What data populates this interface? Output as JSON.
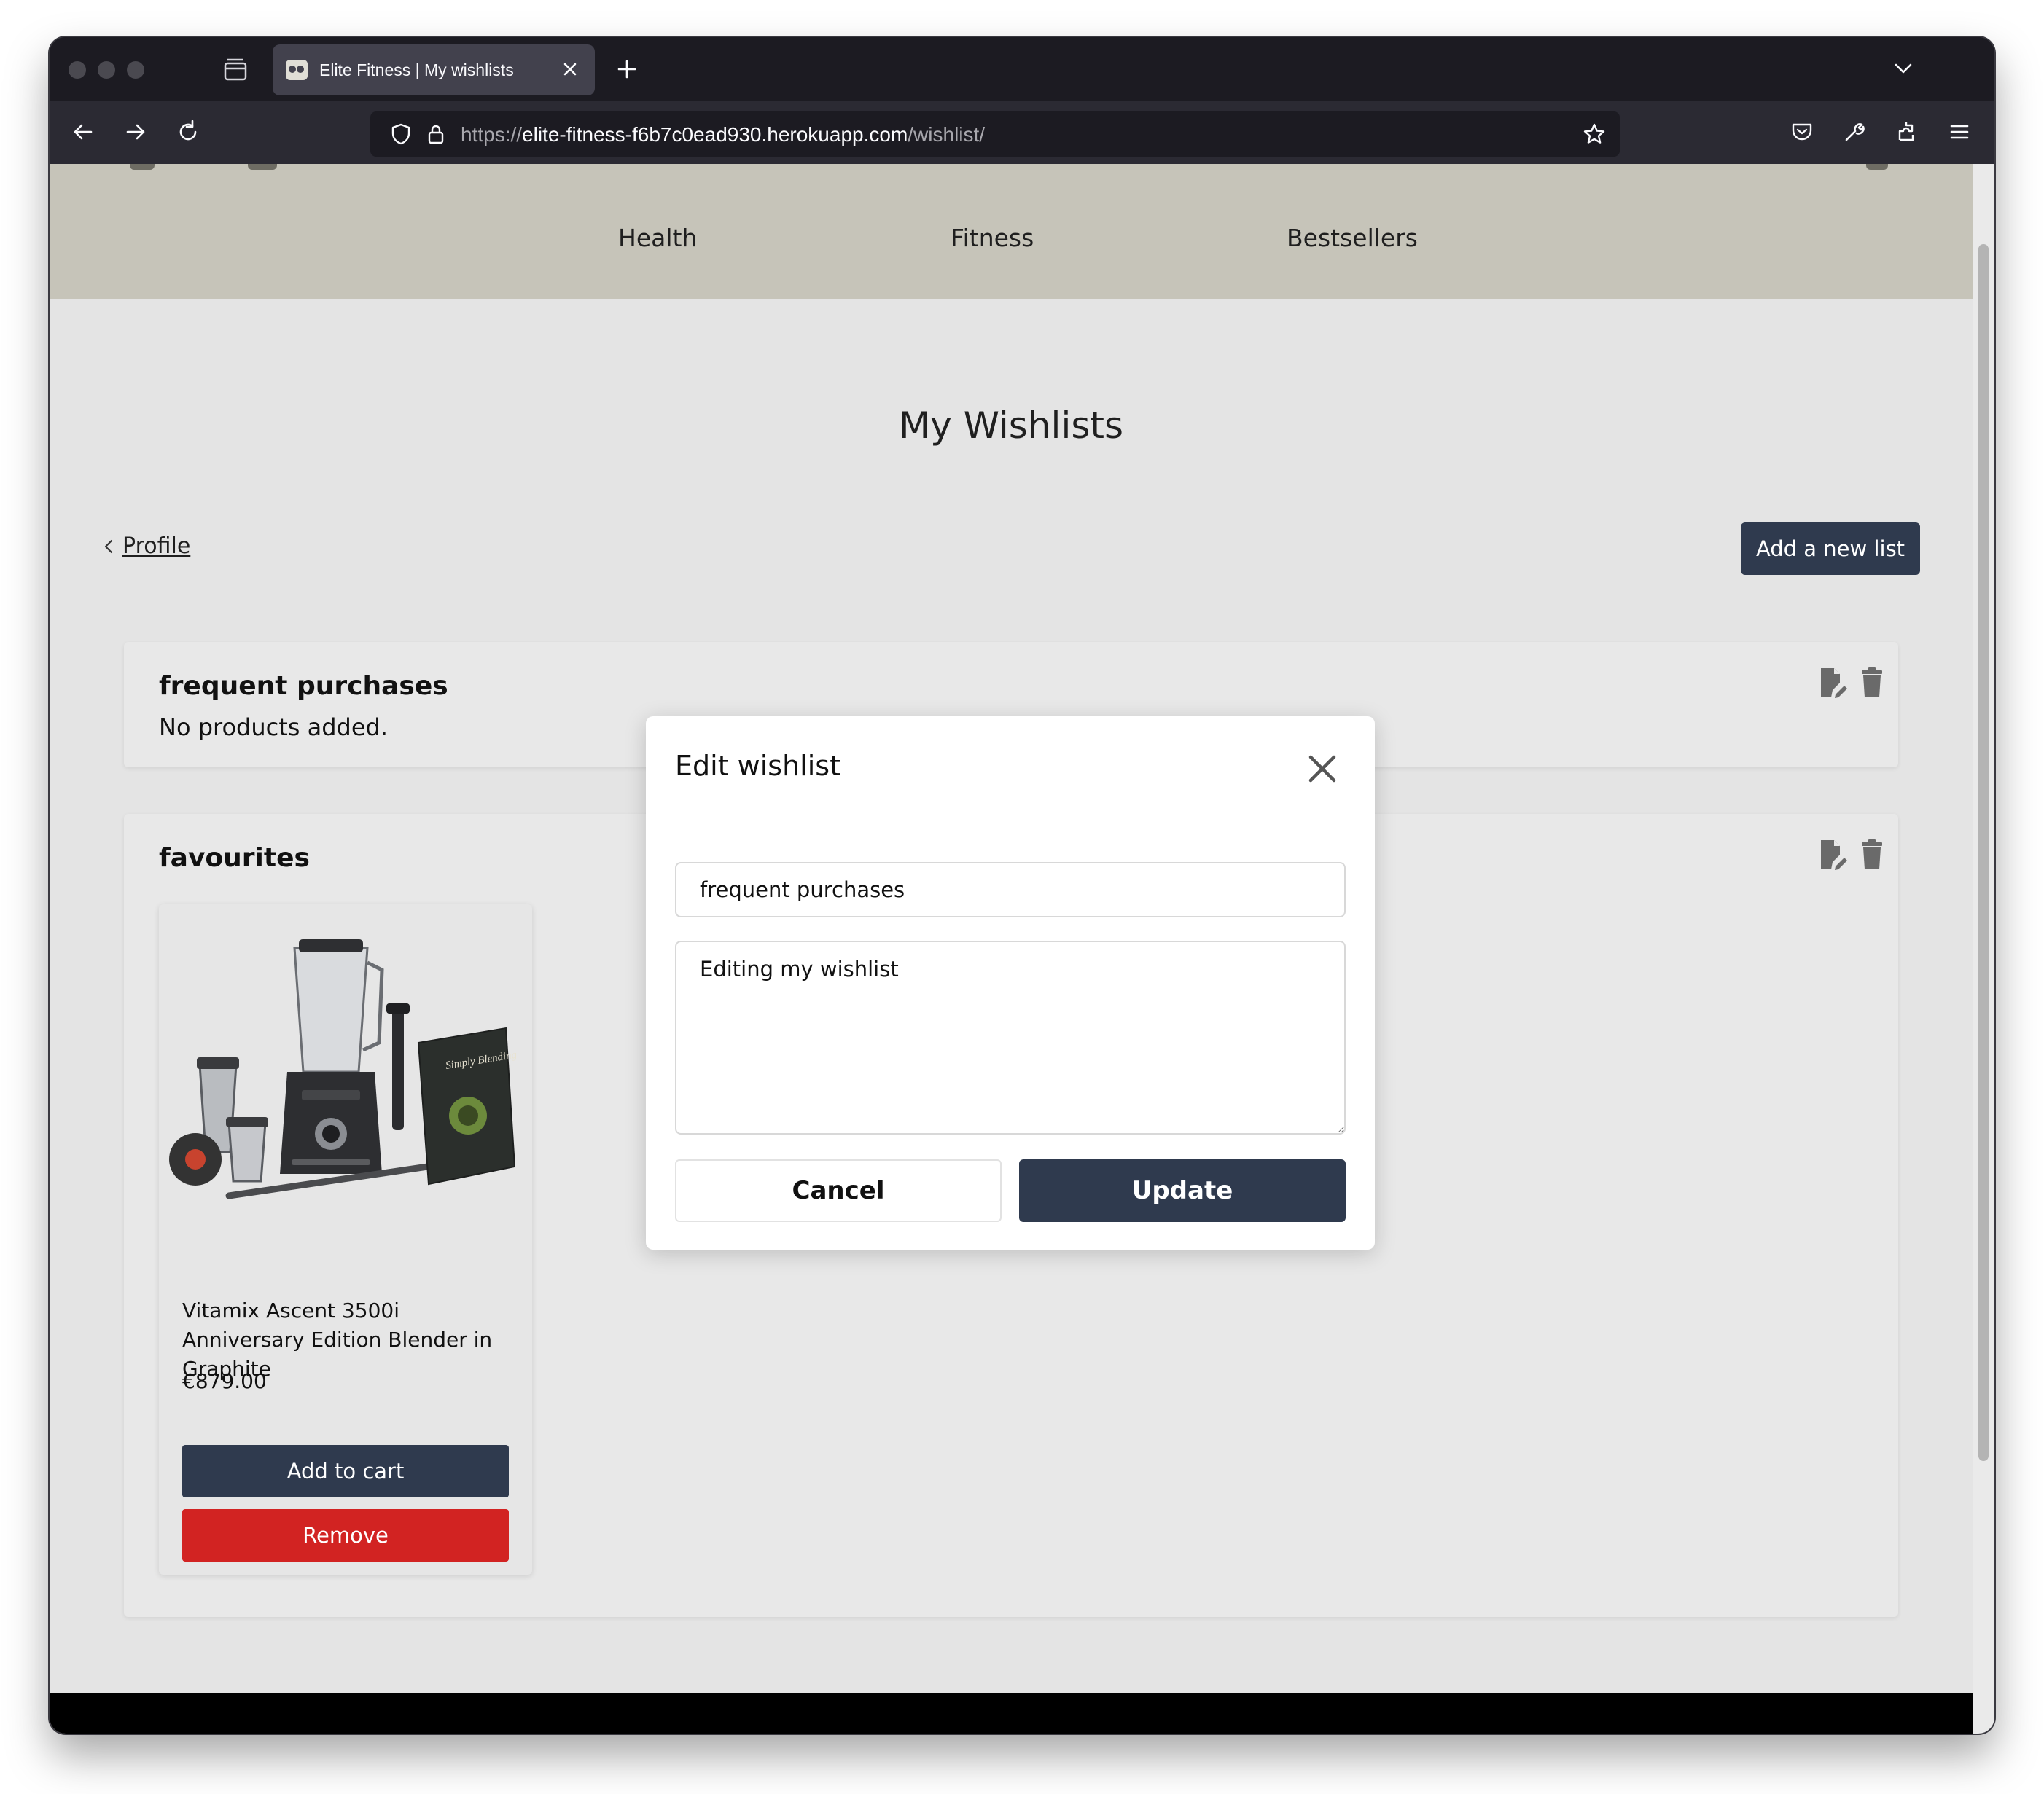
{
  "browser": {
    "tab_title": "Elite Fitness | My wishlists",
    "url_prefix": "https://",
    "url_host": "elite-fitness-f6b7c0ead930.herokuapp.com",
    "url_path": "/wishlist/"
  },
  "site": {
    "nav": [
      "Health",
      "Fitness",
      "Bestsellers"
    ]
  },
  "page": {
    "title": "My Wishlists",
    "back_link": "Profile",
    "add_list_button": "Add a new list"
  },
  "wishlists": [
    {
      "name": "frequent purchases",
      "empty_text": "No products added."
    },
    {
      "name": "favourites",
      "products": [
        {
          "name": "Vitamix Ascent 3500i Anniversary Edition Blender in Graphite",
          "price": "€879.00",
          "add_to_cart": "Add to cart",
          "remove": "Remove",
          "booklet_text": "Simply Blending"
        }
      ]
    }
  ],
  "modal": {
    "title": "Edit wishlist",
    "name_value": "frequent purchases",
    "description_value": "Editing my wishlist",
    "cancel": "Cancel",
    "update": "Update"
  },
  "icons": {
    "edit": "edit-wishlist-icon",
    "delete": "trash-icon",
    "close": "close-icon"
  },
  "colors": {
    "header_bg": "#c6c4b9",
    "primary": "#2f3a4e",
    "danger": "#d22322",
    "page_bg": "#e4e4e4"
  }
}
